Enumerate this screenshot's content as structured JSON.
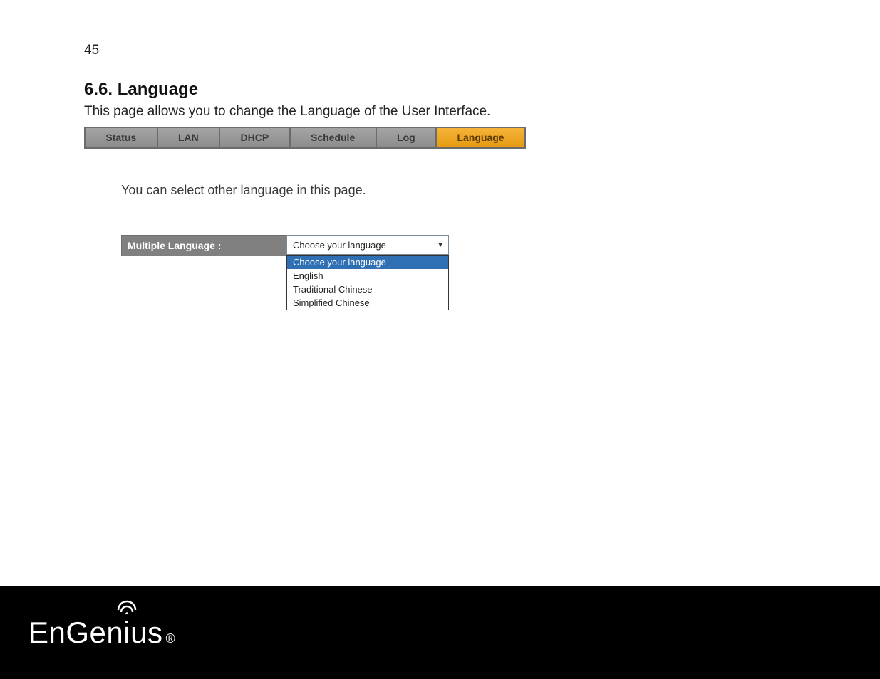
{
  "page_number": "45",
  "section": {
    "heading": "6.6. Language",
    "intro": "This page allows you to change the Language of the User Interface."
  },
  "tabs": {
    "items": [
      {
        "label": "Status",
        "active": false
      },
      {
        "label": "LAN",
        "active": false
      },
      {
        "label": "DHCP",
        "active": false
      },
      {
        "label": "Schedule",
        "active": false
      },
      {
        "label": "Log",
        "active": false
      },
      {
        "label": "Language",
        "active": true
      }
    ]
  },
  "instruction": "You can select other language in this page.",
  "setting": {
    "label": "Multiple Language :",
    "selected": "Choose your language",
    "options": [
      {
        "label": "Choose your language",
        "selected": true
      },
      {
        "label": "English",
        "selected": false
      },
      {
        "label": "Traditional Chinese",
        "selected": false
      },
      {
        "label": "Simplified Chinese",
        "selected": false
      }
    ]
  },
  "footer": {
    "brand_en": "En",
    "brand_gen": "Gen",
    "brand_i": "i",
    "brand_us": "us",
    "reg": "®"
  }
}
